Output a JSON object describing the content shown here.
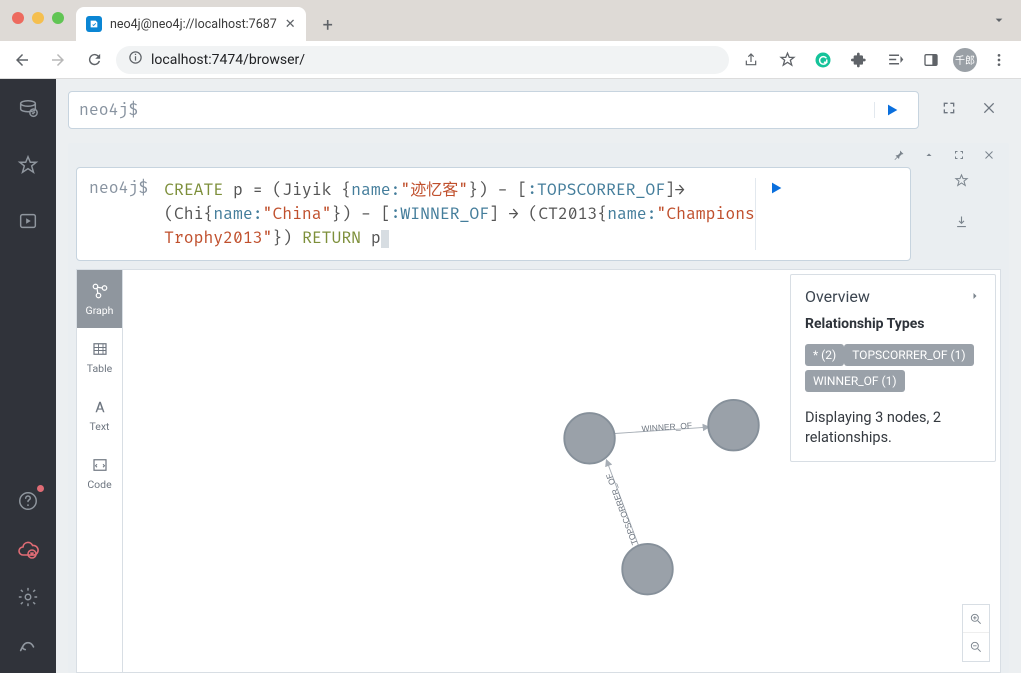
{
  "chrome": {
    "tab_title": "neo4j@neo4j://localhost:7687",
    "url": "localhost:7474/browser/",
    "avatar": "千郎",
    "traffic": {
      "close": "#ed6a5f",
      "min": "#f5bf4f",
      "max": "#61c554"
    }
  },
  "editor": {
    "prompt": "neo4j$"
  },
  "query": {
    "prompt": "neo4j$",
    "tokens": [
      {
        "t": " CREATE",
        "c": "kw"
      },
      {
        "t": " p = (Jiyik {",
        "c": "plain"
      },
      {
        "t": "name:",
        "c": "fn"
      },
      {
        "t": "\"迹忆客\"",
        "c": "str"
      },
      {
        "t": "}) - [",
        "c": "plain"
      },
      {
        "t": ":TOPSCORRER_OF",
        "c": "fn"
      },
      {
        "t": "]→",
        "c": "plain"
      },
      {
        "t": "\n",
        "c": ""
      },
      {
        "t": "(Chi{",
        "c": "plain"
      },
      {
        "t": "name:",
        "c": "fn"
      },
      {
        "t": "\"China\"",
        "c": "str"
      },
      {
        "t": "}) - [",
        "c": "plain"
      },
      {
        "t": ":WINNER_OF",
        "c": "fn"
      },
      {
        "t": "] → (CT2013{",
        "c": "plain"
      },
      {
        "t": "name:",
        "c": "fn"
      },
      {
        "t": "\"Champions ",
        "c": "str"
      },
      {
        "t": "\n",
        "c": ""
      },
      {
        "t": "Trophy2013\"",
        "c": "str"
      },
      {
        "t": "})",
        "c": "plain"
      },
      {
        "t": " RETURN",
        "c": "kw"
      },
      {
        "t": " p",
        "c": "plain"
      }
    ]
  },
  "views": [
    {
      "id": "graph",
      "label": "Graph"
    },
    {
      "id": "table",
      "label": "Table"
    },
    {
      "id": "text",
      "label": "Text"
    },
    {
      "id": "code",
      "label": "Code"
    }
  ],
  "graph": {
    "edges": [
      {
        "label": "WINNER_OF"
      },
      {
        "label": "TOPSCORRER_OF"
      }
    ]
  },
  "overview": {
    "title": "Overview",
    "subtitle": "Relationship Types",
    "pills": [
      "* (2)",
      "TOPSCORRER_OF (1)",
      "WINNER_OF (1)"
    ],
    "footer": "Displaying 3 nodes, 2 relationships."
  }
}
